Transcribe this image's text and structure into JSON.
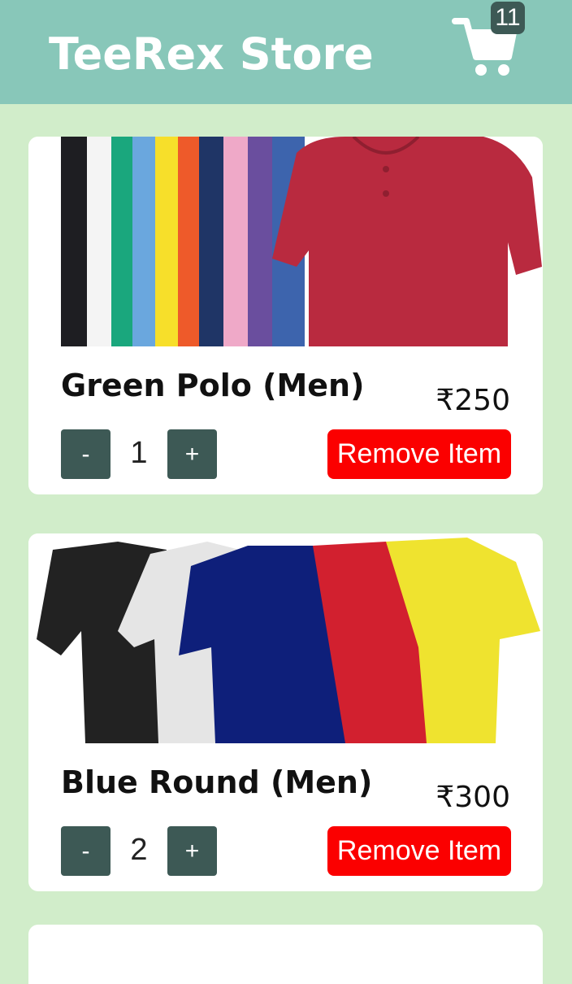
{
  "header": {
    "brand": "TeeRex Store",
    "cart_count": "11",
    "cart_icon": "shopping-cart-icon",
    "bg_color": "#88c7b9"
  },
  "colors": {
    "page_bg": "#d1edca",
    "button_dark": "#3d5955",
    "remove_red": "#fb0000"
  },
  "cart_items": [
    {
      "name": "Green Polo (Men)",
      "price": "₹250",
      "quantity": "1",
      "minus_label": "-",
      "plus_label": "+",
      "remove_label": "Remove Item",
      "image": "polo-shirts-image"
    },
    {
      "name": "Blue Round (Men)",
      "price": "₹300",
      "quantity": "2",
      "minus_label": "-",
      "plus_label": "+",
      "remove_label": "Remove Item",
      "image": "round-neck-tshirts-image"
    }
  ]
}
